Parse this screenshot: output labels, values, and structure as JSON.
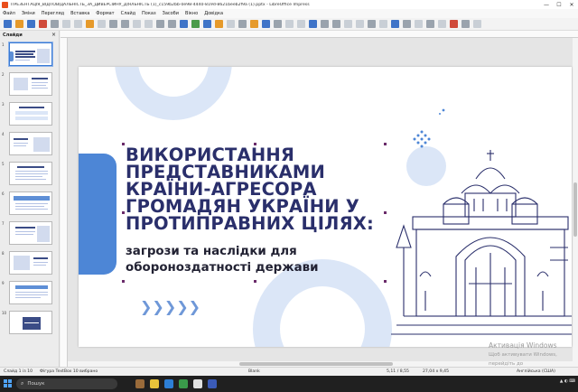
{
  "window": {
    "title": "ПРЕЗЕНТАЦІЯ_ВІДПОВІДАЛЬНІСТЬ_ЗА_ДИВЕРСІЙНУ_ДІЯЛЬНІСТЬ (1)_c159b2bb-0e98-4440-819d-8621beeb2f9a (1).pptx - LibreOffice Impress",
    "minimize": "—",
    "maximize": "☐",
    "close": "✕"
  },
  "menu": [
    "Файл",
    "Зміни",
    "Перегляд",
    "Вставка",
    "Формат",
    "Слайд",
    "Показ",
    "Засоби",
    "Вікно",
    "Довідка"
  ],
  "slide_pane": {
    "title": "Слайди",
    "close": "×",
    "numbers": [
      "1",
      "2",
      "3",
      "4",
      "5",
      "6",
      "7",
      "8",
      "9",
      "10"
    ]
  },
  "slide": {
    "title": "ВИКОРИСТАННЯ ПРЕДСТАВНИКАМИ КРАЇНИ-АГРЕСОРА ГРОМАДЯН УКРАЇНИ У ПРОТИПРАВНИХ ЦІЛЯХ:",
    "subtitle": "загрози та наслідки для обороноздатності держави",
    "chevrons": "❯❯❯❯❯"
  },
  "watermark": {
    "line1": "Активація Windows",
    "line2": "Щоб активувати Windows, перейдіть до"
  },
  "status": {
    "slide": "Слайд 1 із 10",
    "shape": "Фігура TextBox 10 вибрано",
    "layout": "Blank",
    "position": "5,11 / 8,55",
    "size": "27,04 x 9,45",
    "lang": "Англійська (США)"
  },
  "taskbar": {
    "search_placeholder": "Пошук"
  },
  "colors": {
    "title": "#2a2f6b",
    "accent_blue": "#4d86d6",
    "light_blue": "#dbe6f7"
  }
}
